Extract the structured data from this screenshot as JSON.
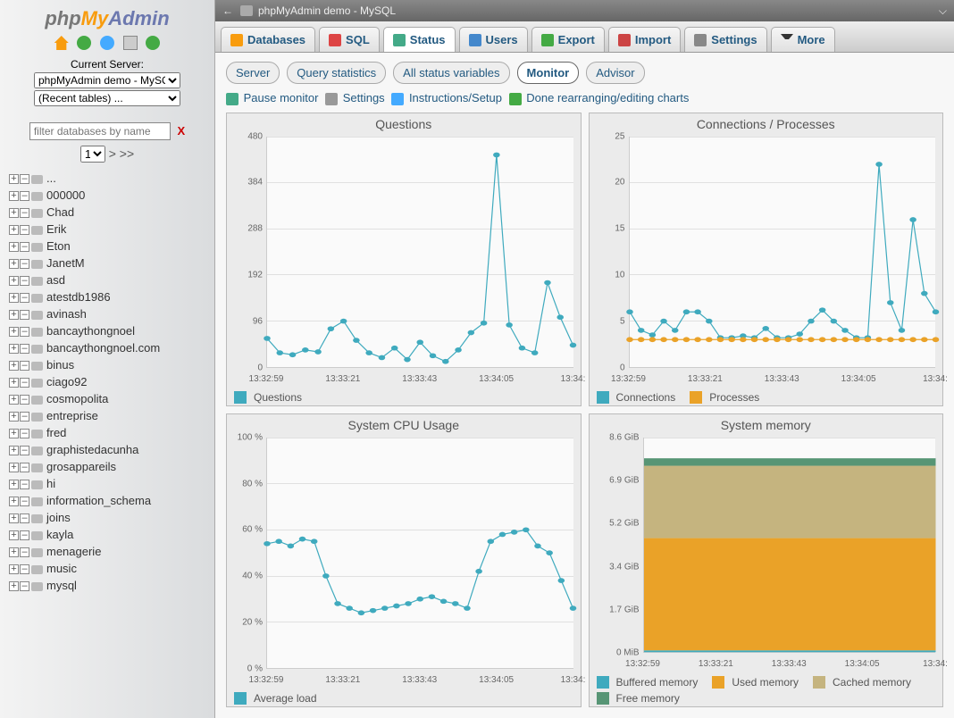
{
  "topbar": {
    "title": "phpMyAdmin demo - MySQL"
  },
  "server": {
    "current_label": "Current Server:",
    "selected": "phpMyAdmin demo - MySQL",
    "recent": "(Recent tables) ...",
    "filter_placeholder": "filter databases by name",
    "page": "1",
    "paging_next": "> >>"
  },
  "databases": [
    "...",
    "000000",
    "Chad",
    "Erik",
    "Eton",
    "JanetM",
    "asd",
    "atestdb1986",
    "avinash",
    "bancaythongnoel",
    "bancaythongnoel.com",
    "binus",
    "ciago92",
    "cosmopolita",
    "entreprise",
    "fred",
    "graphistedacunha",
    "grosappareils",
    "hi",
    "information_schema",
    "joins",
    "kayla",
    "menagerie",
    "music",
    "mysql"
  ],
  "tabs": {
    "databases": "Databases",
    "sql": "SQL",
    "status": "Status",
    "users": "Users",
    "export": "Export",
    "import": "Import",
    "settings": "Settings",
    "more": "More"
  },
  "subtabs": {
    "server": "Server",
    "query": "Query statistics",
    "allvars": "All status variables",
    "monitor": "Monitor",
    "advisor": "Advisor"
  },
  "toolbar": {
    "pause": "Pause monitor",
    "settings": "Settings",
    "instructions": "Instructions/Setup",
    "done": "Done rearranging/editing charts"
  },
  "chart_data": [
    {
      "type": "line",
      "title": "Questions",
      "x_ticks": [
        "13:32:59",
        "13:33:21",
        "13:33:43",
        "13:34:05",
        "13:34:"
      ],
      "y_ticks": [
        0,
        96,
        192,
        288,
        384,
        480
      ],
      "ylim": [
        0,
        480
      ],
      "series": [
        {
          "name": "Questions",
          "color": "#3faabe",
          "values": [
            60,
            30,
            26,
            36,
            32,
            80,
            96,
            56,
            30,
            20,
            40,
            16,
            52,
            24,
            12,
            36,
            72,
            92,
            442,
            88,
            40,
            30,
            176,
            104,
            46
          ]
        }
      ]
    },
    {
      "type": "line",
      "title": "Connections / Processes",
      "x_ticks": [
        "13:32:59",
        "13:33:21",
        "13:33:43",
        "13:34:05",
        "13:34:"
      ],
      "y_ticks": [
        0,
        5,
        10,
        15,
        20,
        25
      ],
      "ylim": [
        0,
        25
      ],
      "series": [
        {
          "name": "Connections",
          "color": "#3faabe",
          "values": [
            6,
            4,
            3.5,
            5,
            4,
            6,
            6,
            5,
            3.2,
            3.2,
            3.4,
            3.2,
            4.2,
            3.2,
            3.2,
            3.6,
            5,
            6.2,
            5,
            4,
            3.2,
            3.2,
            22,
            7,
            4,
            16,
            8,
            6
          ]
        },
        {
          "name": "Processes",
          "color": "#eaa228",
          "values": [
            3,
            3,
            3,
            3,
            3,
            3,
            3,
            3,
            3,
            3,
            3,
            3,
            3,
            3,
            3,
            3,
            3,
            3,
            3,
            3,
            3,
            3,
            3,
            3,
            3,
            3,
            3,
            3
          ]
        }
      ]
    },
    {
      "type": "line",
      "title": "System CPU Usage",
      "x_ticks": [
        "13:32:59",
        "13:33:21",
        "13:33:43",
        "13:34:05",
        "13:34:"
      ],
      "y_ticks": [
        "0 %",
        "20 %",
        "40 %",
        "60 %",
        "80 %",
        "100 %"
      ],
      "ylim": [
        0,
        100
      ],
      "series": [
        {
          "name": "Average load",
          "color": "#3faabe",
          "values": [
            54,
            55,
            53,
            56,
            55,
            40,
            28,
            26,
            24,
            25,
            26,
            27,
            28,
            30,
            31,
            29,
            28,
            26,
            42,
            55,
            58,
            59,
            60,
            53,
            50,
            38,
            26
          ]
        }
      ]
    },
    {
      "type": "area",
      "title": "System memory",
      "x_ticks": [
        "13:32:59",
        "13:33:21",
        "13:33:43",
        "13:34:05",
        "13:34:"
      ],
      "y_ticks": [
        "0 MiB",
        "1.7 GiB",
        "3.4 GiB",
        "5.2 GiB",
        "6.9 GiB",
        "8.6 GiB"
      ],
      "ylim": [
        0,
        8.6
      ],
      "series": [
        {
          "name": "Buffered memory",
          "color": "#3faabe",
          "stack_value": 0.07
        },
        {
          "name": "Used memory",
          "color": "#eaa228",
          "stack_value": 4.5
        },
        {
          "name": "Cached memory",
          "color": "#c5b47f",
          "stack_value": 2.9
        },
        {
          "name": "Free memory",
          "color": "#579575",
          "stack_value": 0.3
        }
      ]
    }
  ]
}
